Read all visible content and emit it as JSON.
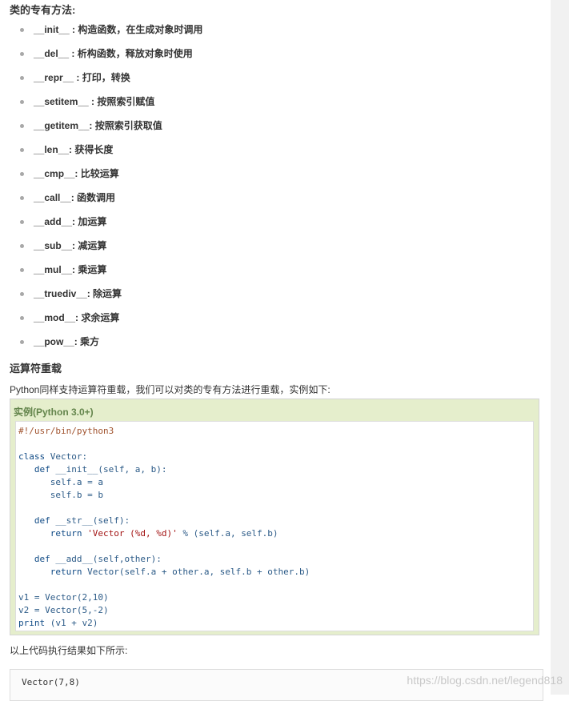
{
  "section_title": "类的专有方法:",
  "methods": [
    {
      "name": "__init__",
      "desc": " : 构造函数，在生成对象时调用"
    },
    {
      "name": "__del__",
      "desc": " : 析构函数，释放对象时使用"
    },
    {
      "name": "__repr__",
      "desc": " : 打印，转换"
    },
    {
      "name": "__setitem__",
      "desc": " : 按照索引赋值"
    },
    {
      "name": "__getitem__",
      "desc": ": 按照索引获取值"
    },
    {
      "name": "__len__",
      "desc": ": 获得长度"
    },
    {
      "name": "__cmp__",
      "desc": ": 比较运算"
    },
    {
      "name": "__call__",
      "desc": ": 函数调用"
    },
    {
      "name": "__add__",
      "desc": ": 加运算"
    },
    {
      "name": "__sub__",
      "desc": ": 减运算"
    },
    {
      "name": "__mul__",
      "desc": ": 乘运算"
    },
    {
      "name": "__truediv__",
      "desc": ": 除运算"
    },
    {
      "name": "__mod__",
      "desc": ": 求余运算"
    },
    {
      "name": "__pow__",
      "desc": ": 乘方"
    }
  ],
  "overload_title": "运算符重载",
  "overload_intro": "Python同样支持运算符重载，我们可以对类的专有方法进行重载，实例如下:",
  "example_title": "实例(Python 3.0+)",
  "code": {
    "shebang": "#!/usr/bin/python3",
    "class_kw": "class",
    "class_name": " Vector:",
    "init_def": "def",
    "init_sig": " __init__(self, a, b):",
    "init_a": "self.a = a",
    "init_b": "self.b = b",
    "str_def": "def",
    "str_sig": " __str__(self):",
    "str_return": "return",
    "str_string": "'Vector (%d, %d)'",
    "str_rest": " % (self.a, self.b)",
    "add_def": "def",
    "add_sig": " __add__(self,other):",
    "add_return": "return",
    "add_rest": " Vector(self.a + other.a, self.b + other.b)",
    "v1": "v1 = Vector(2,10)",
    "v2": "v2 = Vector(5,-2)",
    "print_kw": "print",
    "print_rest": " (v1 + v2)"
  },
  "result_label": "以上代码执行结果如下所示:",
  "output": "Vector(7,8)",
  "watermark": "https://blog.csdn.net/legend818"
}
